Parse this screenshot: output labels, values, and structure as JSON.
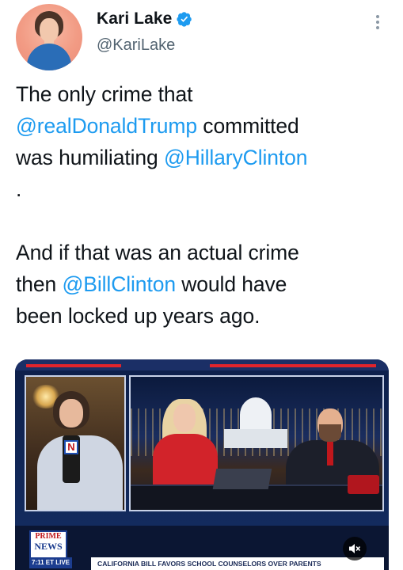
{
  "author": {
    "display_name": "Kari Lake",
    "handle": "@KariLake",
    "verified": true,
    "verified_color": "#1d9bf0"
  },
  "tweet": {
    "line1": "The only crime that",
    "mention1": "@realDonaldTrump",
    "after_mention1": " committed",
    "line3_prefix": "was humiliating ",
    "mention2": "@HillaryClinton",
    "period": ".",
    "para2_line1": "And if that was an actual crime",
    "para2_prefix": "then ",
    "mention3": "@BillClinton",
    "para2_after_mention": " would have",
    "para2_line3": "been locked up years ago.",
    "mention_color": "#1d9bf0"
  },
  "media": {
    "mic_flag": "N",
    "logo_line1": "PRIME",
    "logo_line2": "NEWS",
    "time_live": "7:11 ET   LIVE",
    "crawl_text": "CALIFORNIA BILL FAVORS SCHOOL COUNSELORS OVER PARENTS",
    "mute_icon": "speaker-muted-icon"
  }
}
